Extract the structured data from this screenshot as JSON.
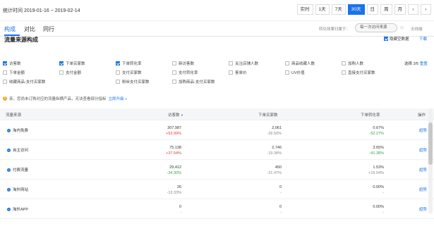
{
  "header": {
    "stat_time": "统计时间 2019-01-16 ~ 2019-02-14",
    "time_tabs": [
      "实时",
      "1天",
      "7天",
      "30天",
      "日",
      "周",
      "月"
    ],
    "active_tab": "30天",
    "accent": "#1a73e8"
  },
  "subtabs": [
    "构成",
    "对比",
    "同行"
  ],
  "conversion": {
    "label": "转化效果归属于：",
    "select_value": "每一次访问来源",
    "unbound": "无线端"
  },
  "section": {
    "title": "流量来源构成",
    "hide_empty": "隐藏空数据",
    "download": "下载"
  },
  "metrics": [
    {
      "label": "访客数",
      "checked": true
    },
    {
      "label": "下单买家数",
      "checked": true
    },
    {
      "label": "下单转化率",
      "checked": true
    },
    {
      "label": "新访客数",
      "checked": false
    },
    {
      "label": "关注店铺人数",
      "checked": false
    },
    {
      "label": "商品收藏人数",
      "checked": false
    },
    {
      "label": "加购人数",
      "checked": false
    },
    {
      "label": "下单金额",
      "checked": false
    },
    {
      "label": "支付金额",
      "checked": false
    },
    {
      "label": "支付买家数",
      "checked": false
    },
    {
      "label": "支付转化率",
      "checked": false
    },
    {
      "label": "客单价",
      "checked": false
    },
    {
      "label": "UV价值",
      "checked": false
    },
    {
      "label": "直接支付买家数",
      "checked": false
    },
    {
      "label": "收藏商品-支付买家数",
      "checked": false
    },
    {
      "label": "粉丝支付买家数",
      "checked": false
    },
    {
      "label": "加购商品-支付买家数",
      "checked": false
    }
  ],
  "choose": {
    "text": "选择 3/5",
    "reset": "重置"
  },
  "notice": {
    "text": "亲，您尚未订购对应的流量纵横产品，无法查看部分指标",
    "link": "立即升级 »"
  },
  "table": {
    "headers": {
      "source": "流量来源",
      "visitors": "访客数",
      "buyers": "下单买家数",
      "rate": "下单转化率",
      "action": "操作"
    },
    "rows": [
      {
        "source": "淘内免费",
        "visitors": "307,987",
        "visitors_chg": "+53.99%",
        "visitors_dir": "up",
        "buyers": "2,061",
        "buyers_chg": "-26.50%",
        "buyers_dir": "flat",
        "rate": "0.67%",
        "rate_chg": "-52.27%",
        "rate_dir": "down",
        "action": "趋势"
      },
      {
        "source": "自主访问",
        "visitors": "75,138",
        "visitors_chg": "+37.54%",
        "visitors_dir": "up",
        "buyers": "2,746",
        "buyers_chg": "-19.38%",
        "buyers_dir": "flat",
        "rate": "3.65%",
        "rate_chg": "-41.38%",
        "rate_dir": "down",
        "action": "趋势"
      },
      {
        "source": "付费流量",
        "visitors": "29,412",
        "visitors_chg": "-34.30%",
        "visitors_dir": "down",
        "buyers": "450",
        "buyers_chg": "-21.47%",
        "buyers_dir": "flat",
        "rate": "1.53%",
        "rate_chg": "+19.54%",
        "rate_dir": "flat",
        "action": "趋势"
      },
      {
        "source": "淘外网站",
        "visitors": "26",
        "visitors_chg": "-13.33%",
        "visitors_dir": "flat",
        "buyers": "0",
        "buyers_chg": "-",
        "buyers_dir": "flat",
        "rate": "0.00%",
        "rate_chg": "-",
        "rate_dir": "flat",
        "action": "趋势"
      },
      {
        "source": "淘外APP",
        "visitors": "0",
        "visitors_chg": "-",
        "visitors_dir": "flat",
        "buyers": "0",
        "buyers_chg": "-",
        "buyers_dir": "flat",
        "rate": "0.00%",
        "rate_chg": "-",
        "rate_dir": "flat",
        "action": "趋势"
      }
    ]
  }
}
